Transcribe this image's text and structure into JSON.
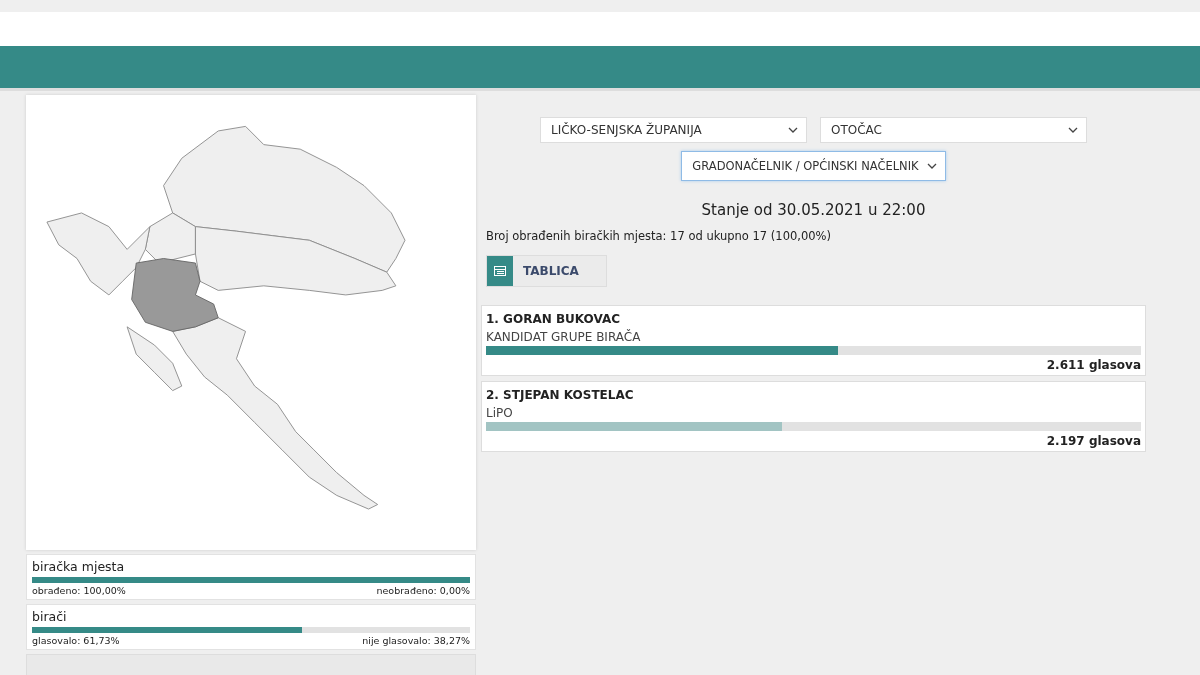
{
  "filters": {
    "county": "LIČKO-SENJSKA ŽUPANIJA",
    "municipality": "OTOČAC",
    "election": "GRADONAČELNIK / OPĆINSKI NAČELNIK"
  },
  "status_title": "Stanje od 30.05.2021 u 22:00",
  "processed_text": "Broj obrađenih biračkih mjesta: 17 od ukupno 17 (100,00%)",
  "table_button": "TABLICA",
  "candidates": [
    {
      "name": "1. GORAN BUKOVAC",
      "party": "KANDIDAT GRUPE BIRAČA",
      "level": 0.537,
      "color": "#358a87",
      "votes": "2.611 glasova"
    },
    {
      "name": "2. STJEPAN KOSTELAC",
      "party": "LiPO",
      "level": 0.452,
      "color": "#a2c4c3",
      "votes": "2.197 glasova"
    }
  ],
  "stats": [
    {
      "title": "biračka mjesta",
      "level": 1.0,
      "left": "obrađeno: 100,00%",
      "right": "neobrađeno: 0,00%"
    },
    {
      "title": "birači",
      "level": 0.617,
      "left": "glasovalo: 61,73%",
      "right": "nije glasovalo: 38,27%"
    }
  ]
}
